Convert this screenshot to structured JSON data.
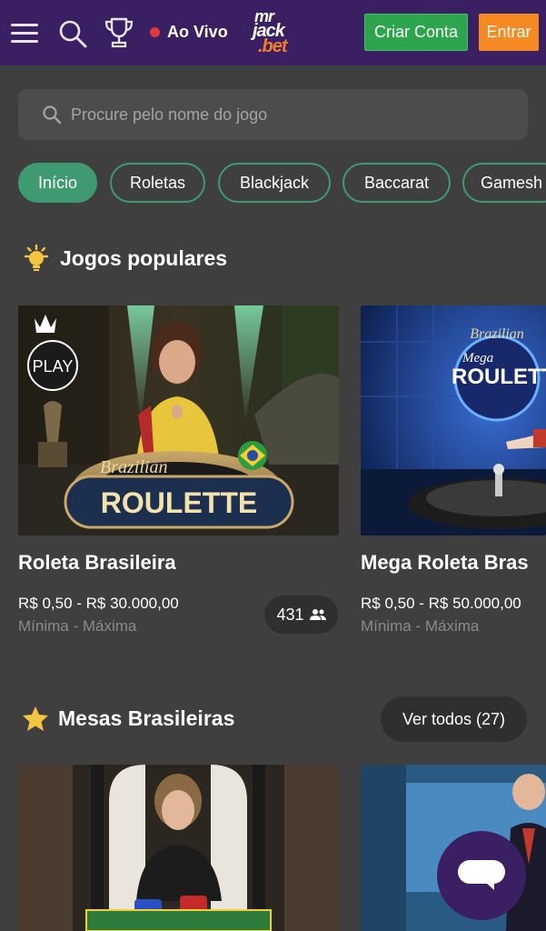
{
  "header": {
    "live_label": "Ao Vivo",
    "logo": {
      "line1": "mr",
      "line2": "jack",
      "line3": ".bet"
    },
    "signup_label": "Criar Conta",
    "login_label": "Entrar"
  },
  "search": {
    "placeholder": "Procure pelo nome do jogo"
  },
  "tabs": [
    {
      "label": "Início",
      "active": true
    },
    {
      "label": "Roletas",
      "active": false
    },
    {
      "label": "Blackjack",
      "active": false
    },
    {
      "label": "Baccarat",
      "active": false
    },
    {
      "label": "Gamesh",
      "active": false
    }
  ],
  "popular": {
    "title": "Jogos populares",
    "games": [
      {
        "name": "Roleta Brasileira",
        "range": "R$ 0,50 - R$ 30.000,00",
        "range_sub": "Mínima - Máxima",
        "players": "431",
        "image_text": {
          "script": "Brazilian",
          "main": "ROULETTE",
          "badge": "PLAY"
        }
      },
      {
        "name": "Mega Roleta Bras",
        "range": "R$ 0,50 - R$ 50.000,00",
        "range_sub": "Mínima - Máxima",
        "image_text": {
          "script": "Brazilian",
          "line1": "Mega",
          "main": "ROULETTE"
        }
      }
    ]
  },
  "brazilian_tables": {
    "title": "Mesas Brasileiras",
    "view_all_label": "Ver todos (27)"
  },
  "colors": {
    "header_bg": "#3a1f63",
    "page_bg": "#3f3f3f",
    "accent_green": "#3f9a72",
    "signup_green": "#2da54d",
    "login_orange": "#f58a22",
    "logo_orange": "#f07d2c",
    "live_red": "#e03a3e"
  },
  "icons": [
    "menu-icon",
    "search-icon",
    "trophy-icon",
    "sun-icon",
    "star-icon",
    "players-icon",
    "chat-icon"
  ]
}
